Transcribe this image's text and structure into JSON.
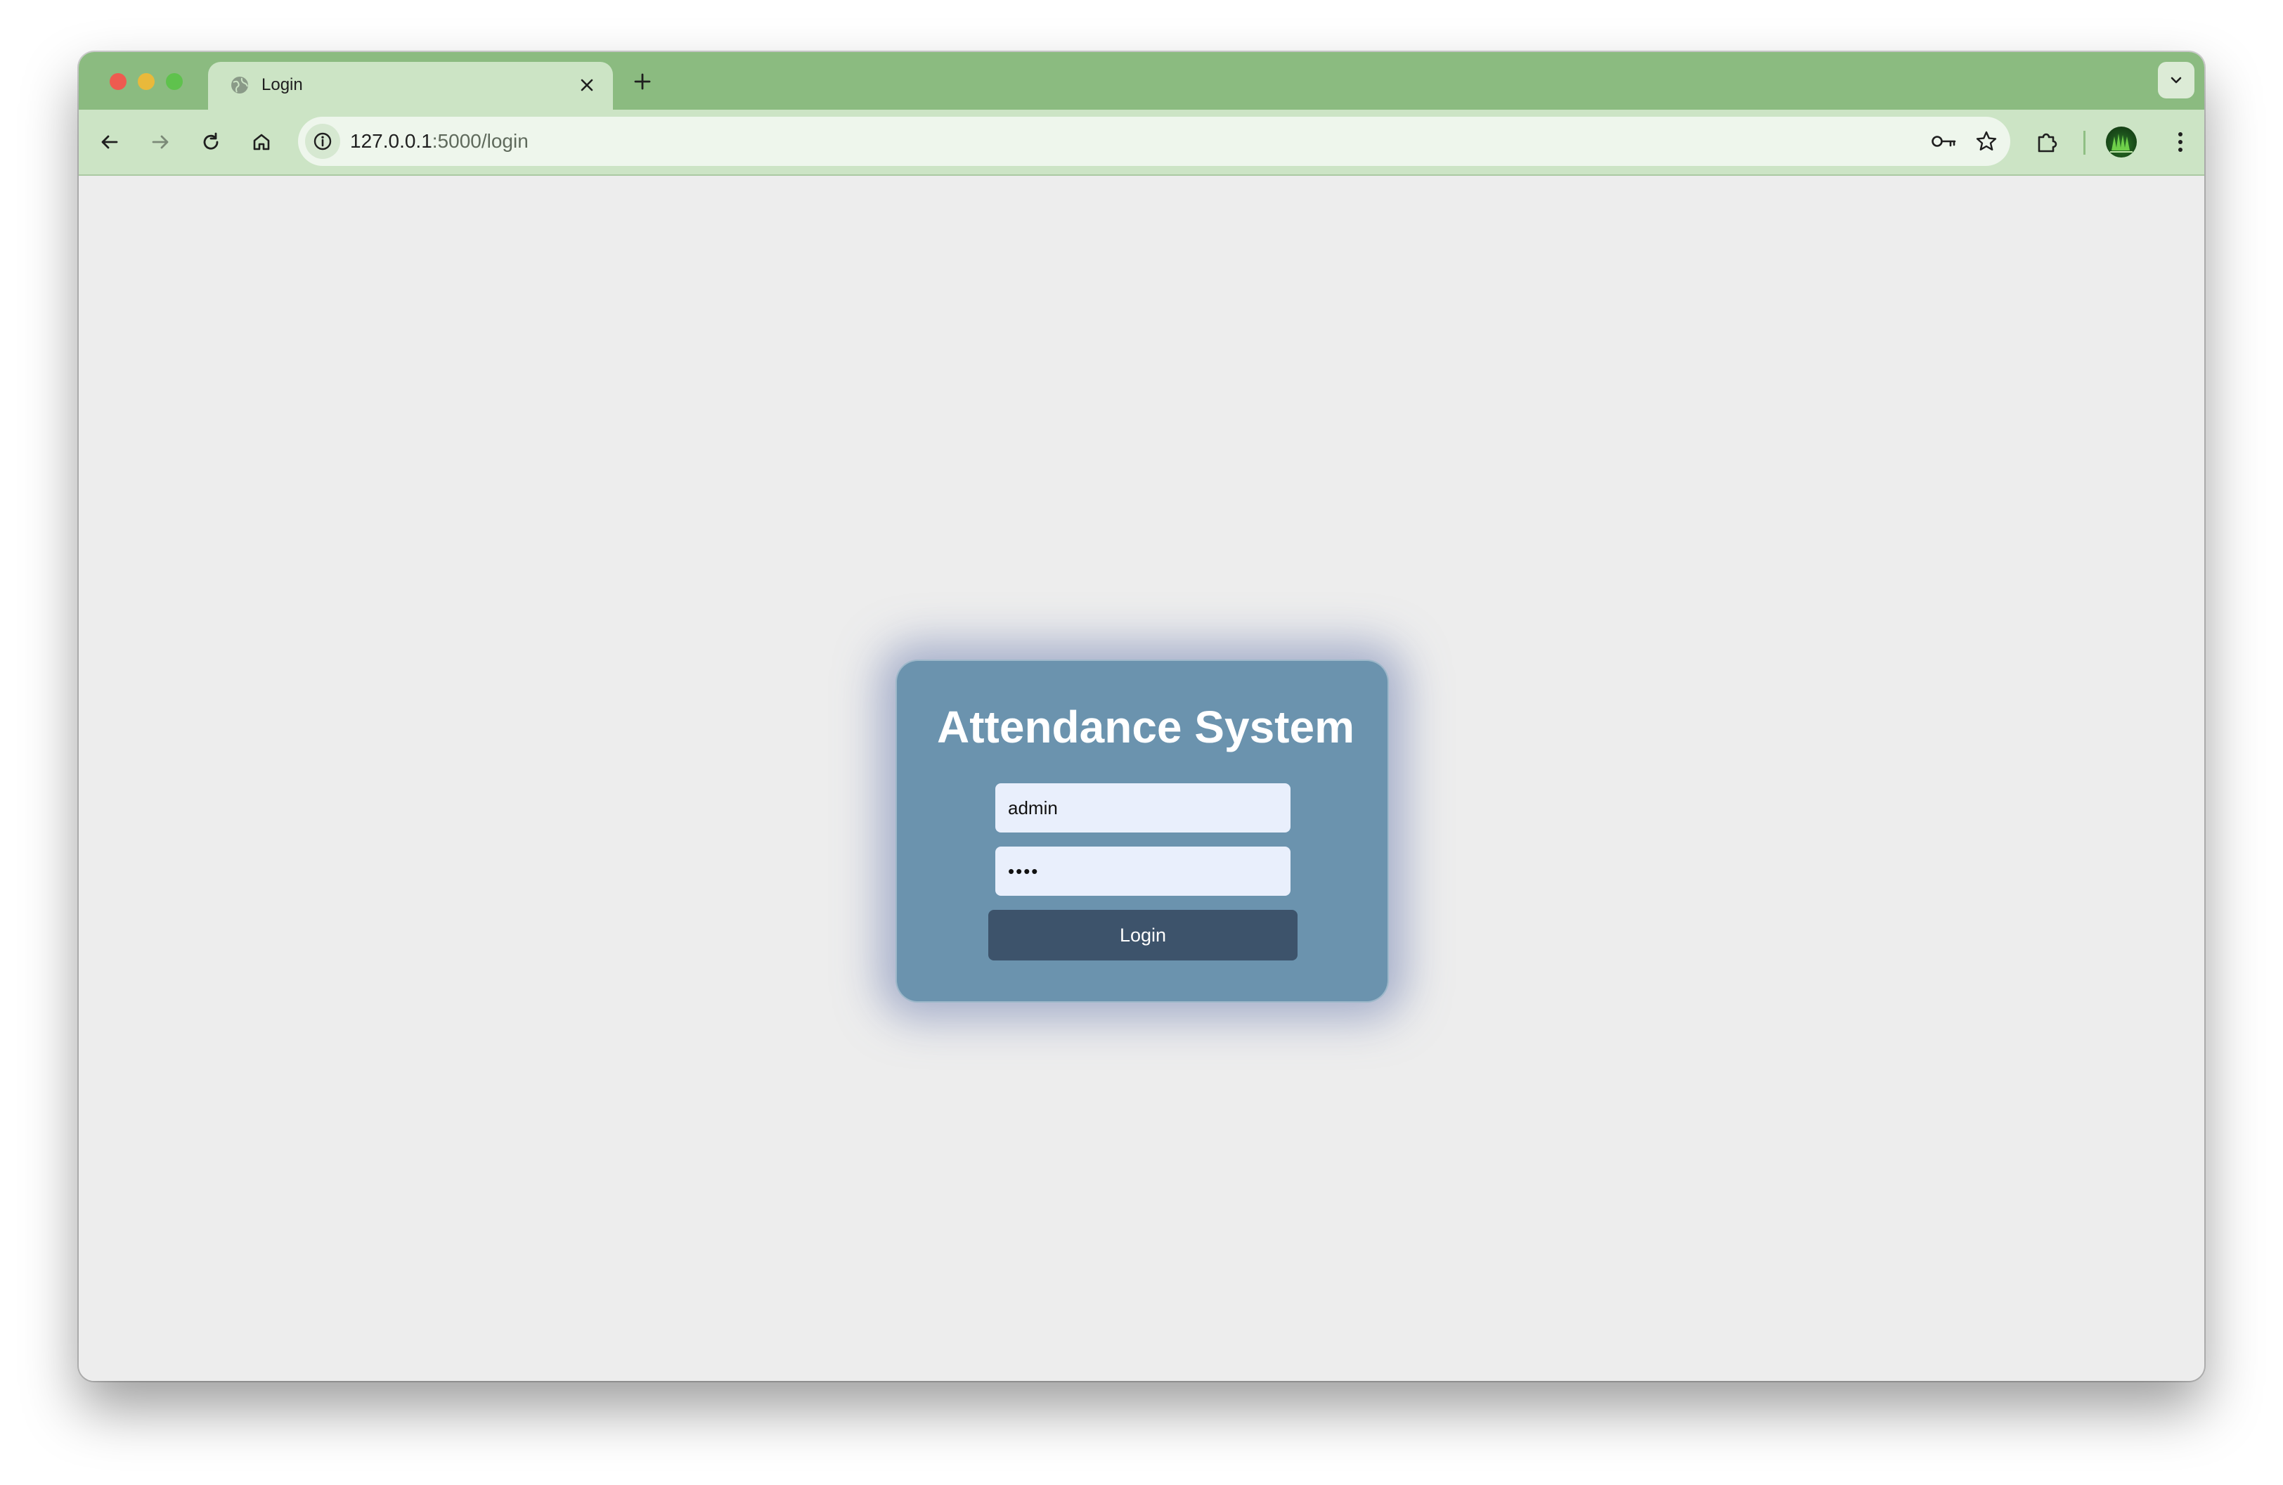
{
  "browser": {
    "tab": {
      "title": "Login",
      "icon": "globe-icon"
    },
    "url": {
      "host": "127.0.0.1",
      "path": ":5000/login"
    },
    "toolbar_icons": [
      "back-icon",
      "forward-icon",
      "reload-icon",
      "home-icon",
      "info-icon",
      "key-icon",
      "star-icon",
      "extensions-icon",
      "profile-avatar",
      "more-icon"
    ],
    "colors": {
      "tabstrip": "#8bbb80",
      "toolbar": "#cce4c5"
    }
  },
  "login_card": {
    "title": "Attendance System",
    "username_value": "admin",
    "password_value": "••••",
    "button_label": "Login",
    "colors": {
      "card": "#6b93ae",
      "button": "#3d536b",
      "field": "#e9effc"
    }
  }
}
